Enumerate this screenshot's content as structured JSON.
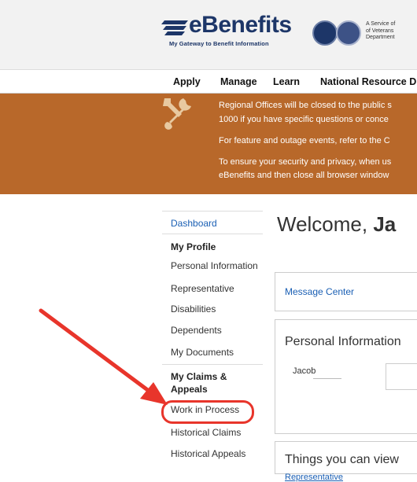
{
  "header": {
    "logo_text": "eBenefits",
    "logo_tagline": "My Gateway to Benefit Information",
    "service_text": [
      "A Service of",
      "of Veterans",
      "Department"
    ]
  },
  "nav": {
    "items": [
      "Apply",
      "Manage",
      "Learn",
      "National Resource Di"
    ]
  },
  "banner": {
    "lines": [
      "Regional Offices will be closed to the public s",
      "1000 if you have specific questions or conce",
      "For feature and outage events, refer to the C",
      "To ensure your security and privacy, when us",
      "eBenefits and then close all browser window"
    ],
    "color": "#b8682a"
  },
  "sidebar": {
    "dashboard": "Dashboard",
    "my_profile": "My Profile",
    "personal_information": "Personal Information",
    "representative": "Representative",
    "disabilities": "Disabilities",
    "dependents": "Dependents",
    "my_documents": "My Documents",
    "claims_heading_1": "My Claims &",
    "claims_heading_2": "Appeals",
    "work_in_process": "Work in Process",
    "historical_claims": "Historical Claims",
    "historical_appeals": "Historical Appeals"
  },
  "main": {
    "welcome_prefix": "Welcome, ",
    "welcome_name": "Ja",
    "message_center": "Message Center",
    "personal_info_title": "Personal Information",
    "first_name": "Jacob",
    "things_title": "Things you can view",
    "things_link": "Representative"
  },
  "annotation": {
    "color": "#e8352b"
  }
}
